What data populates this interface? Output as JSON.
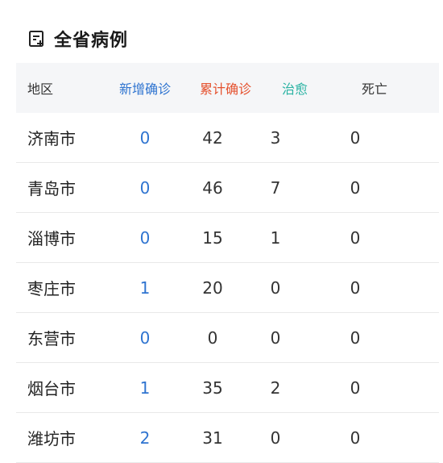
{
  "header": {
    "title": "全省病例",
    "icon": "report-icon"
  },
  "table": {
    "columns": {
      "region": "地区",
      "new": "新增确诊",
      "total": "累计确诊",
      "cured": "治愈",
      "dead": "死亡"
    },
    "colors": {
      "new": "#2f74d0",
      "total": "#e5522f",
      "cured": "#2ab3a3"
    },
    "rows": [
      {
        "region": "济南市",
        "new": "0",
        "total": "42",
        "cured": "3",
        "dead": "0"
      },
      {
        "region": "青岛市",
        "new": "0",
        "total": "46",
        "cured": "7",
        "dead": "0"
      },
      {
        "region": "淄博市",
        "new": "0",
        "total": "15",
        "cured": "1",
        "dead": "0"
      },
      {
        "region": "枣庄市",
        "new": "1",
        "total": "20",
        "cured": "0",
        "dead": "0"
      },
      {
        "region": "东营市",
        "new": "0",
        "total": "0",
        "cured": "0",
        "dead": "0"
      },
      {
        "region": "烟台市",
        "new": "1",
        "total": "35",
        "cured": "2",
        "dead": "0"
      },
      {
        "region": "潍坊市",
        "new": "2",
        "total": "31",
        "cured": "0",
        "dead": "0"
      }
    ]
  }
}
